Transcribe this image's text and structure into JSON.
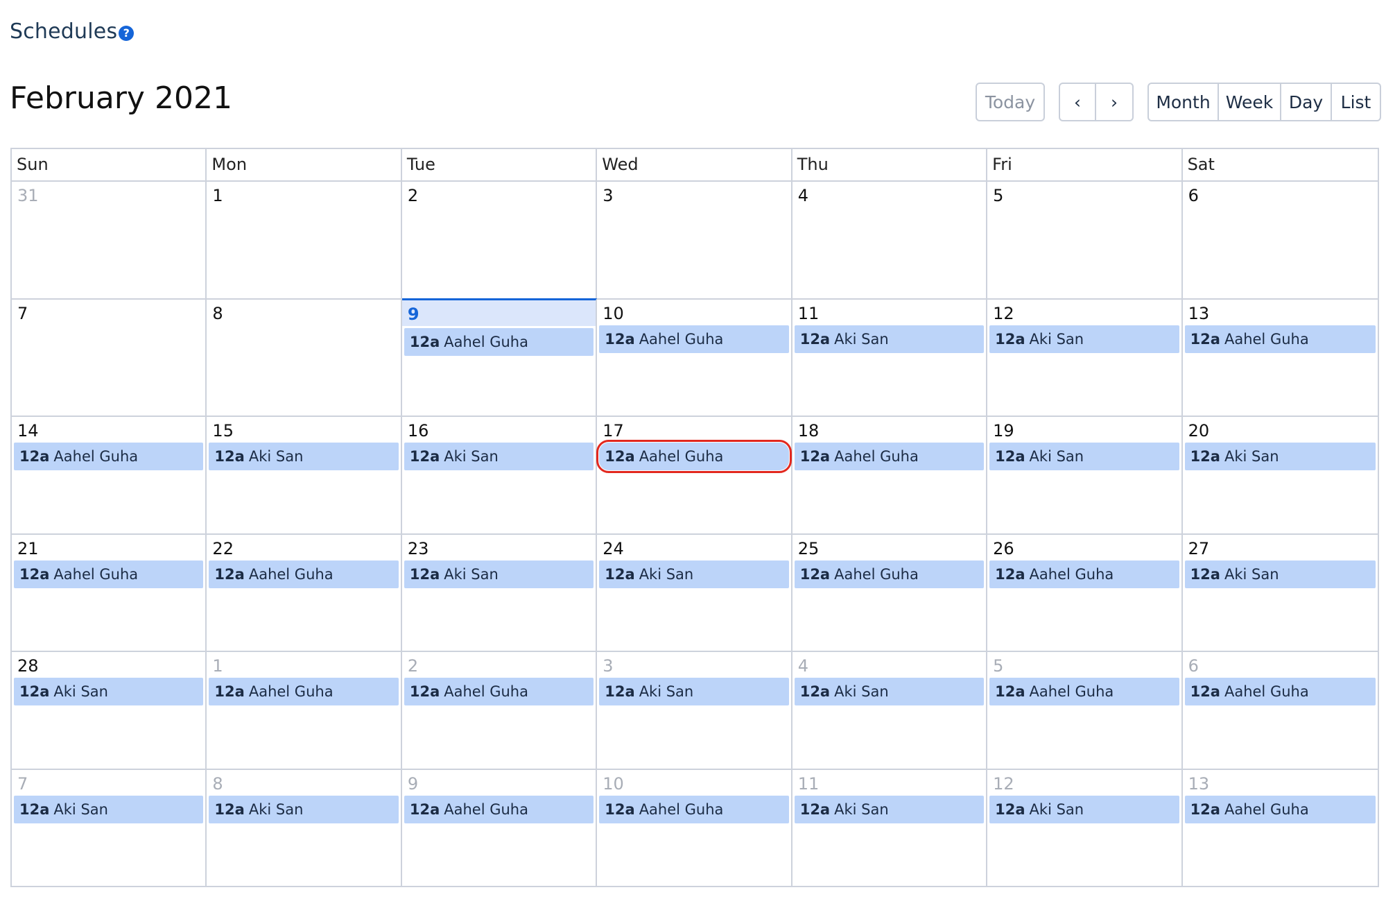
{
  "header": {
    "title": "Schedules",
    "help_icon": "?"
  },
  "month_title": "February 2021",
  "toolbar": {
    "today": "Today",
    "prev": "‹",
    "next": "›",
    "views": [
      "Month",
      "Week",
      "Day",
      "List"
    ]
  },
  "colors": {
    "event_bg": "#bcd4f9",
    "today_accent": "#1565d8",
    "highlight_outline": "#e2281f"
  },
  "calendar": {
    "weekdays": [
      "Sun",
      "Mon",
      "Tue",
      "Wed",
      "Thu",
      "Fri",
      "Sat"
    ],
    "weeks": [
      [
        {
          "date": "31",
          "other": true,
          "event": null
        },
        {
          "date": "1",
          "event": null
        },
        {
          "date": "2",
          "event": null
        },
        {
          "date": "3",
          "event": null
        },
        {
          "date": "4",
          "event": null
        },
        {
          "date": "5",
          "event": null
        },
        {
          "date": "6",
          "event": null
        }
      ],
      [
        {
          "date": "7",
          "event": null
        },
        {
          "date": "8",
          "event": null
        },
        {
          "date": "9",
          "today": true,
          "event": {
            "time": "12a",
            "name": "Aahel Guha"
          }
        },
        {
          "date": "10",
          "event": {
            "time": "12a",
            "name": "Aahel Guha"
          }
        },
        {
          "date": "11",
          "event": {
            "time": "12a",
            "name": "Aki San"
          }
        },
        {
          "date": "12",
          "event": {
            "time": "12a",
            "name": "Aki San"
          }
        },
        {
          "date": "13",
          "event": {
            "time": "12a",
            "name": "Aahel Guha"
          }
        }
      ],
      [
        {
          "date": "14",
          "event": {
            "time": "12a",
            "name": "Aahel Guha"
          }
        },
        {
          "date": "15",
          "event": {
            "time": "12a",
            "name": "Aki San"
          }
        },
        {
          "date": "16",
          "event": {
            "time": "12a",
            "name": "Aki San"
          }
        },
        {
          "date": "17",
          "event": {
            "time": "12a",
            "name": "Aahel Guha",
            "highlight": true
          }
        },
        {
          "date": "18",
          "event": {
            "time": "12a",
            "name": "Aahel Guha"
          }
        },
        {
          "date": "19",
          "event": {
            "time": "12a",
            "name": "Aki San"
          }
        },
        {
          "date": "20",
          "event": {
            "time": "12a",
            "name": "Aki San"
          }
        }
      ],
      [
        {
          "date": "21",
          "event": {
            "time": "12a",
            "name": "Aahel Guha"
          }
        },
        {
          "date": "22",
          "event": {
            "time": "12a",
            "name": "Aahel Guha"
          }
        },
        {
          "date": "23",
          "event": {
            "time": "12a",
            "name": "Aki San"
          }
        },
        {
          "date": "24",
          "event": {
            "time": "12a",
            "name": "Aki San"
          }
        },
        {
          "date": "25",
          "event": {
            "time": "12a",
            "name": "Aahel Guha"
          }
        },
        {
          "date": "26",
          "event": {
            "time": "12a",
            "name": "Aahel Guha"
          }
        },
        {
          "date": "27",
          "event": {
            "time": "12a",
            "name": "Aki San"
          }
        }
      ],
      [
        {
          "date": "28",
          "event": {
            "time": "12a",
            "name": "Aki San"
          }
        },
        {
          "date": "1",
          "other": true,
          "event": {
            "time": "12a",
            "name": "Aahel Guha"
          }
        },
        {
          "date": "2",
          "other": true,
          "event": {
            "time": "12a",
            "name": "Aahel Guha"
          }
        },
        {
          "date": "3",
          "other": true,
          "event": {
            "time": "12a",
            "name": "Aki San"
          }
        },
        {
          "date": "4",
          "other": true,
          "event": {
            "time": "12a",
            "name": "Aki San"
          }
        },
        {
          "date": "5",
          "other": true,
          "event": {
            "time": "12a",
            "name": "Aahel Guha"
          }
        },
        {
          "date": "6",
          "other": true,
          "event": {
            "time": "12a",
            "name": "Aahel Guha"
          }
        }
      ],
      [
        {
          "date": "7",
          "other": true,
          "event": {
            "time": "12a",
            "name": "Aki San"
          }
        },
        {
          "date": "8",
          "other": true,
          "event": {
            "time": "12a",
            "name": "Aki San"
          }
        },
        {
          "date": "9",
          "other": true,
          "event": {
            "time": "12a",
            "name": "Aahel Guha"
          }
        },
        {
          "date": "10",
          "other": true,
          "event": {
            "time": "12a",
            "name": "Aahel Guha"
          }
        },
        {
          "date": "11",
          "other": true,
          "event": {
            "time": "12a",
            "name": "Aki San"
          }
        },
        {
          "date": "12",
          "other": true,
          "event": {
            "time": "12a",
            "name": "Aki San"
          }
        },
        {
          "date": "13",
          "other": true,
          "event": {
            "time": "12a",
            "name": "Aahel Guha"
          }
        }
      ]
    ]
  }
}
